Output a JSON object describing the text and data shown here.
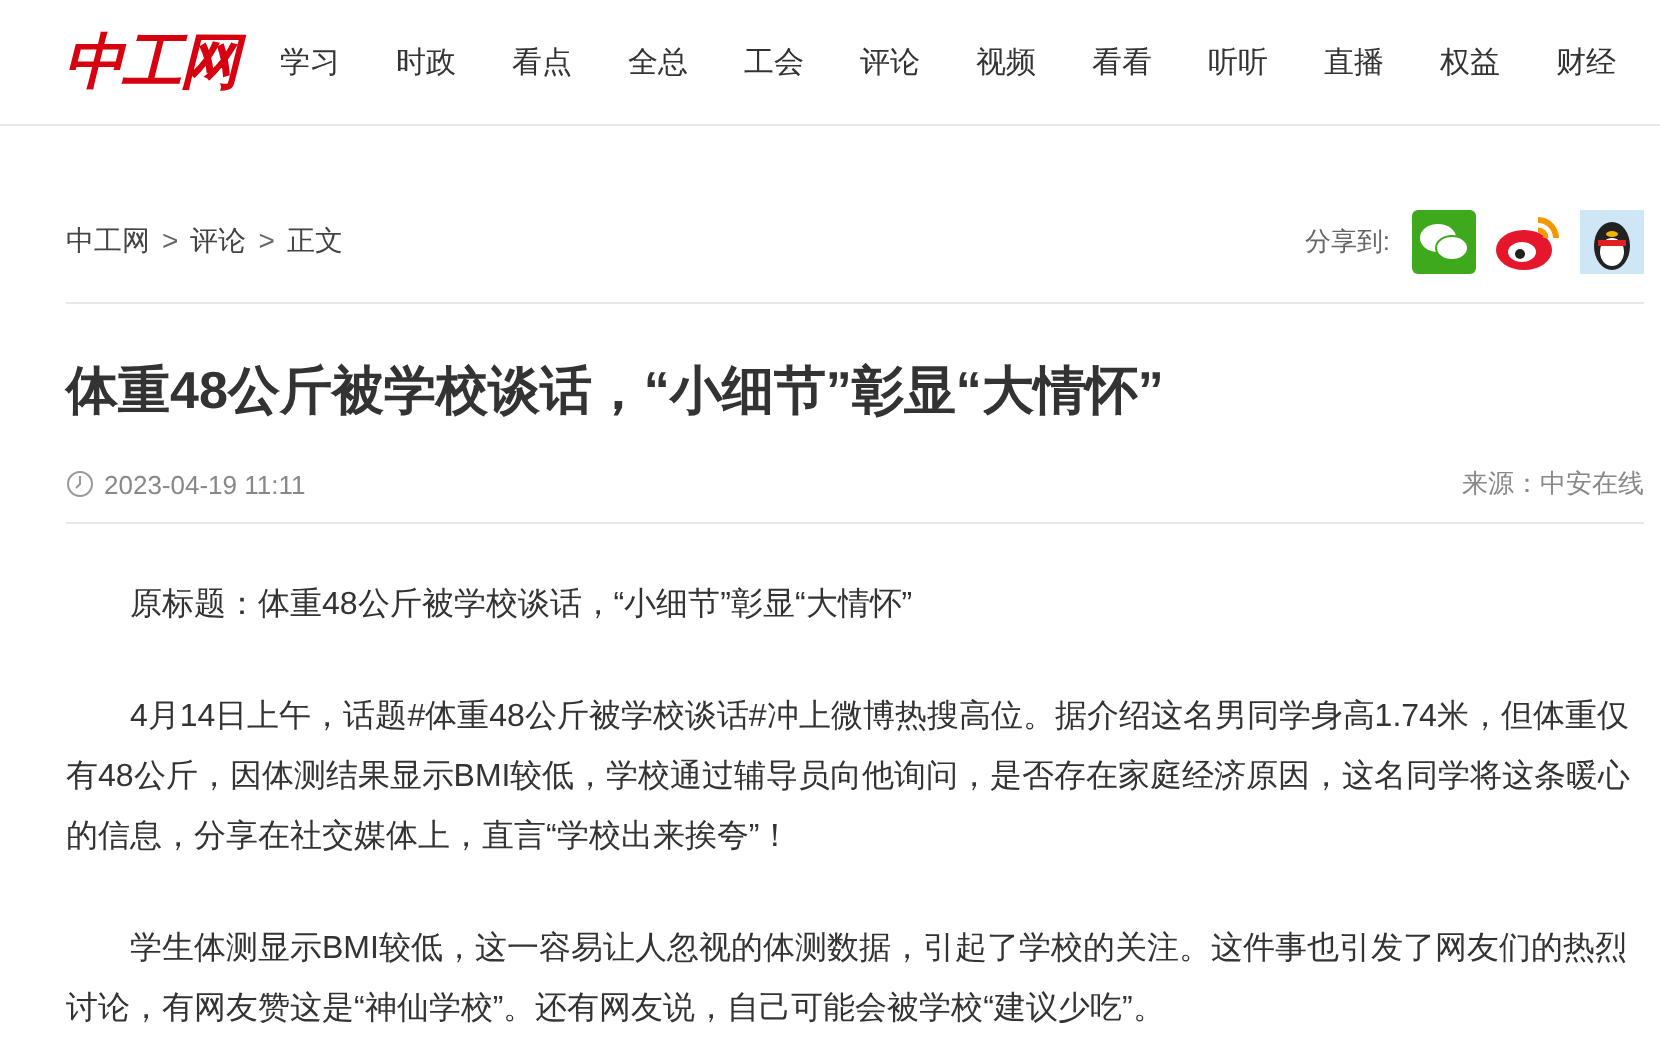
{
  "header": {
    "logo": "中工网",
    "nav": [
      {
        "label": "学习"
      },
      {
        "label": "时政"
      },
      {
        "label": "看点"
      },
      {
        "label": "全总"
      },
      {
        "label": "工会"
      },
      {
        "label": "评论"
      },
      {
        "label": "视频"
      },
      {
        "label": "看看"
      },
      {
        "label": "听听"
      },
      {
        "label": "直播"
      },
      {
        "label": "权益"
      },
      {
        "label": "财经"
      }
    ]
  },
  "breadcrumb": {
    "items": [
      "中工网",
      "评论",
      "正文"
    ],
    "separator": ">"
  },
  "share": {
    "label": "分享到:",
    "targets": [
      {
        "kind": "wechat"
      },
      {
        "kind": "weibo"
      },
      {
        "kind": "qq"
      }
    ]
  },
  "article": {
    "title": "体重48公斤被学校谈话，“小细节”彰显“大情怀”",
    "date": "2023-04-19 11:11",
    "source": "来源：中安在线",
    "paragraphs": [
      "原标题：体重48公斤被学校谈话，“小细节”彰显“大情怀”",
      "4月14日上午，话题#体重48公斤被学校谈话#冲上微博热搜高位。据介绍这名男同学身高1.74米，但体重仅有48公斤，因体测结果显示BMI较低，学校通过辅导员向他询问，是否存在家庭经济原因，这名同学将这条暖心的信息，分享在社交媒体上，直言“学校出来挨夸”！",
      "学生体测显示BMI较低，这一容易让人忽视的体测数据，引起了学校的关注。这件事也引发了网友们的热烈讨论，有网友赞这是“神仙学校”。还有网友说，自己可能会被学校“建议少吃”。"
    ]
  }
}
